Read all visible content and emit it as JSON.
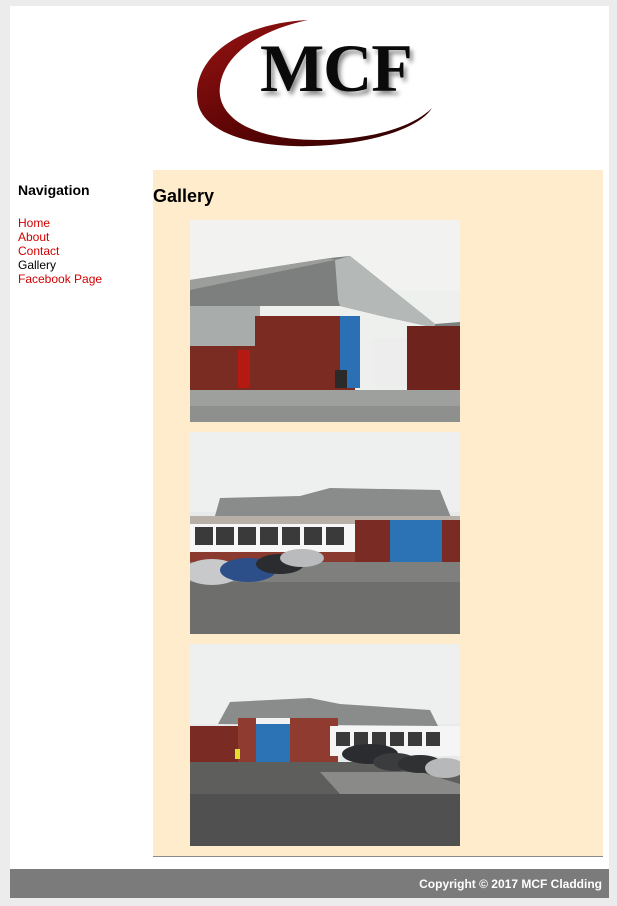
{
  "header": {
    "logo_text": "MCF",
    "logo_color": "#7a0a0a"
  },
  "sidebar": {
    "heading": "Navigation",
    "items": [
      {
        "label": "Home",
        "current": false
      },
      {
        "label": "About",
        "current": false
      },
      {
        "label": "Contact",
        "current": false
      },
      {
        "label": "Gallery",
        "current": true
      },
      {
        "label": "Facebook Page",
        "current": false
      }
    ]
  },
  "main": {
    "title": "Gallery",
    "photos": [
      {
        "subject": "industrial building with blue roller door and red side door"
      },
      {
        "subject": "industrial building with parked cars in front"
      },
      {
        "subject": "industrial building with blue roller door and car park"
      }
    ]
  },
  "footer": {
    "copyright": "Copyright © 2017 MCF Cladding"
  },
  "colors": {
    "link": "#d40000",
    "content_bg": "#ffeccc",
    "footer_bg": "#7b7b7b",
    "page_bg": "#ececec"
  }
}
